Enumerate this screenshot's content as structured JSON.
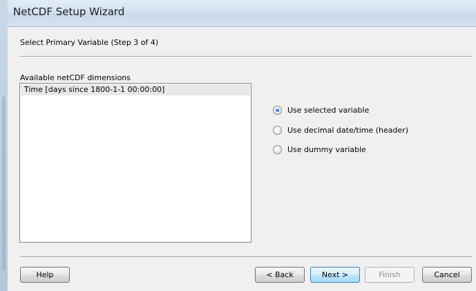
{
  "window": {
    "title": "NetCDF Setup Wizard"
  },
  "wizard": {
    "step_label": "Select Primary Variable (Step 3 of 4)",
    "dimensions_label": "Available netCDF dimensions",
    "dimensions": [
      "Time [days since 1800-1-1 00:00:00]"
    ],
    "options": [
      {
        "label": "Use selected variable",
        "checked": true
      },
      {
        "label": "Use decimal date/time (header)",
        "checked": false
      },
      {
        "label": "Use dummy variable",
        "checked": false
      }
    ]
  },
  "buttons": {
    "help": "Help",
    "back": "< Back",
    "next": "Next >",
    "finish": "Finish",
    "cancel": "Cancel"
  },
  "colors": {
    "accent": "#3c7fb1",
    "radio_fill": "#1f66c8",
    "list_selection": "#e8e8e8"
  }
}
